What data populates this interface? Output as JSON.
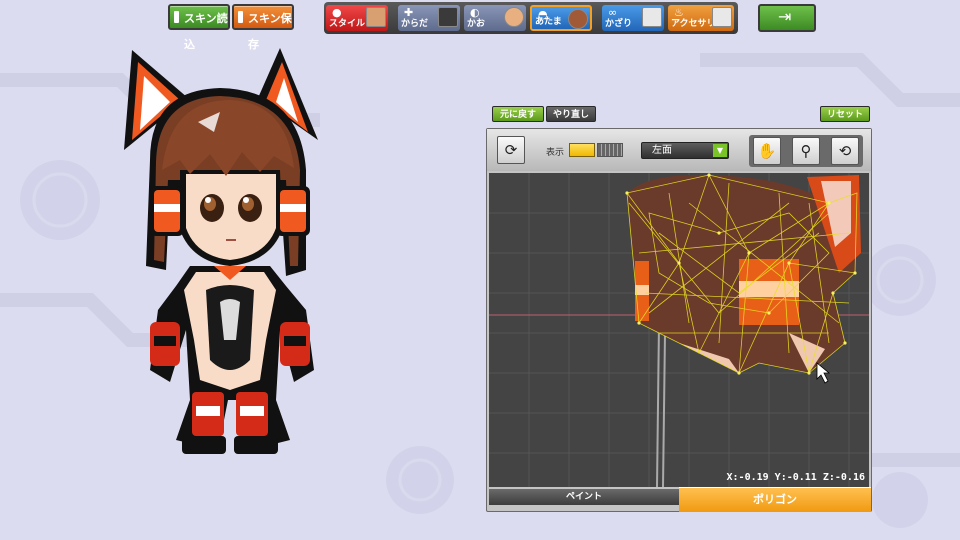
{
  "toolbar_top": {
    "skin_load_label": "スキン読込",
    "skin_save_label": "スキン保存"
  },
  "categories": [
    {
      "label": "スタイル",
      "icon": "face-icon"
    },
    {
      "label": "からだ",
      "icon": "body-icon"
    },
    {
      "label": "かお",
      "icon": "face-icon"
    },
    {
      "label": "あたま",
      "icon": "hair-icon",
      "selected": true
    },
    {
      "label": "かざり",
      "icon": "glasses-icon"
    },
    {
      "label": "アクセサリ",
      "icon": "accessory-icon"
    }
  ],
  "exit_icon": "exit-door-icon",
  "editor": {
    "undo_label": "元に戻す",
    "redo_label": "やり直し",
    "reset_label": "リセット",
    "display_label": "表示",
    "view_select_value": "左面",
    "coord_readout": "X:-0.19 Y:-0.11 Z:-0.16",
    "bottom_tabs": {
      "paint": "ペイント",
      "polygon": "ポリゴン"
    }
  },
  "colors": {
    "accent_orange": "#f09a10",
    "accent_green": "#5c9a1c",
    "wire_yellow": "#e8e020"
  }
}
